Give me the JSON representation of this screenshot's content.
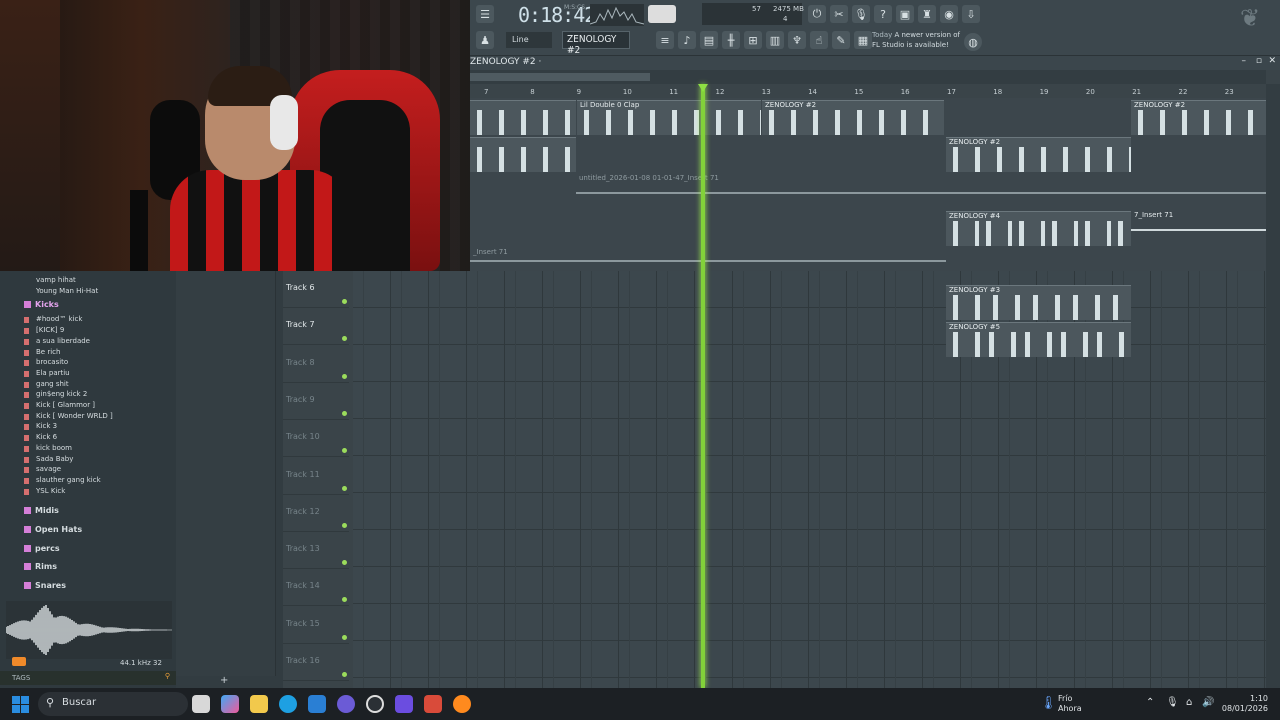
{
  "toolbar": {
    "time": "0:18:42",
    "time_sub": "M:S:CS",
    "cpu": "57",
    "memory": "2475 MB",
    "memory_sub": "4",
    "snap": "Line",
    "pattern": "ZENOLOGY #2",
    "news_day": "Today",
    "news_text": "A newer version of FL Studio is available!"
  },
  "playlist": {
    "title": "ZENOLOGY #2 ·",
    "ruler": [
      "7",
      "8",
      "9",
      "10",
      "11",
      "12",
      "13",
      "14",
      "15",
      "16",
      "17",
      "18",
      "19",
      "20",
      "21",
      "22",
      "23"
    ]
  },
  "clips": {
    "lil_double": "Lil Double 0 Clap",
    "zen2a": "ZENOLOGY #2",
    "zen2b": "ZENOLOGY #2",
    "zen2c": "ZENOLOGY #2",
    "audio1": "untitled_2026-01-08 01-01-47_Insert 71",
    "zen4": "ZENOLOGY #4",
    "insert71": "7_Insert 71",
    "audio2": "_Insert 71",
    "zen3": "ZENOLOGY #3",
    "zen5": "ZENOLOGY #5"
  },
  "browser": {
    "top_items": [
      "vamp hihat",
      "Young Man Hi-Hat"
    ],
    "kicks_folder": "Kicks",
    "kicks": [
      "#hood™ kick",
      "[KICK] 9",
      "a sua liberdade",
      "Be rich",
      "brocasito",
      "Ela partiu",
      "gang shit",
      "gin$eng kick 2",
      "Kick [ Glammor ]",
      "Kick [ Wonder WRLD ]",
      "Kick 3",
      "Kick 6",
      "kick boom",
      "Sada Baby",
      "savage",
      "slauther gang kick",
      "YSL Kick"
    ],
    "folders": [
      "Midis",
      "Open Hats",
      "percs",
      "Rims",
      "Snares"
    ],
    "wave_info": "44.1 kHz 32",
    "tags": "TAGS"
  },
  "tracks": [
    {
      "name": "Track 6",
      "active": true
    },
    {
      "name": "Track 7",
      "active": true
    },
    {
      "name": "Track 8",
      "active": false
    },
    {
      "name": "Track 9",
      "active": false
    },
    {
      "name": "Track 10",
      "active": false
    },
    {
      "name": "Track 11",
      "active": false
    },
    {
      "name": "Track 12",
      "active": false
    },
    {
      "name": "Track 13",
      "active": false
    },
    {
      "name": "Track 14",
      "active": false
    },
    {
      "name": "Track 15",
      "active": false
    },
    {
      "name": "Track 16",
      "active": false
    }
  ],
  "taskbar": {
    "search": "Buscar",
    "weather_1": "Frío",
    "weather_2": "Ahora",
    "time": "1:10",
    "date": "08/01/2026"
  },
  "colors": {
    "playhead": "#82d13a",
    "folder_icon": "#c778d8",
    "accent": "#2a8de0"
  }
}
